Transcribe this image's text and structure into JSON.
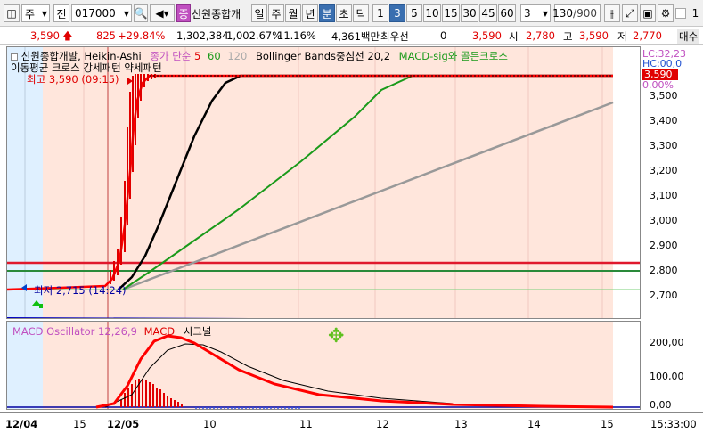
{
  "toolbar": {
    "stock_prefix": "주",
    "exchange_select": "전",
    "stock_code": "017000",
    "search_badge": "증",
    "stock_name": "신원종합개",
    "period_tabs": [
      "일",
      "주",
      "월",
      "년",
      "분",
      "초",
      "틱"
    ],
    "selected_period": "분",
    "minute_options": [
      "1",
      "3",
      "5",
      "10",
      "15",
      "30",
      "45",
      "60"
    ],
    "selected_minute": "3",
    "unit_value": "3",
    "count_display": "130",
    "count_total": "/900",
    "toggle_label": "1"
  },
  "quote": {
    "price": "3,590",
    "change": "825",
    "change_pct": "+29.84%",
    "volume": "1,302,384",
    "volume_ratio": "1,002.67%",
    "turnover_rate": "11.16%",
    "amount": "4,361백만",
    "pref_label": "최우선",
    "pref_value": "0",
    "ask": "3,590",
    "open_label": "시",
    "open": "2,780",
    "high_label": "고",
    "high": "3,590",
    "low_label": "저",
    "low": "2,770",
    "extra_label": "매수"
  },
  "main_legend": {
    "stock": "신원종합개발, Heikin-Ashi",
    "ma_label": "종가 단순",
    "ma5": "5",
    "ma60": "60",
    "ma120": "120",
    "bollinger": "Bollinger Bands중심선 20,2",
    "macd_signal": "MACD-sig와 골든크로스",
    "pattern_line": "이동평균 크로스 강세패턴   약세패턴",
    "high_marker": "최고 3,590 (09:15)",
    "low_marker": "최저 2,715 (14:24)"
  },
  "price_axis": {
    "lc": "LC:32,23",
    "hc": "HC:00,0",
    "current": "3,590",
    "current_pct": "0.00%",
    "ticks": [
      "3,500",
      "3,400",
      "3,300",
      "3,200",
      "3,100",
      "3,000",
      "2,900",
      "2,800",
      "2,700"
    ]
  },
  "osc_legend": {
    "osc": "MACD Oscillator 12,26,9",
    "macd": "MACD",
    "signal": "시그널"
  },
  "osc_axis": {
    "ticks": [
      "200,00",
      "100,00",
      "0,00"
    ]
  },
  "time_axis": {
    "labels": [
      "12/04",
      "15",
      "12/05",
      "10",
      "11",
      "12",
      "13",
      "14",
      "15"
    ],
    "clock": "15:33:00"
  },
  "colors": {
    "ma5": "#ff0000",
    "ma20": "#000000",
    "ma60": "#1a9a1a",
    "ma120": "#9a9a9a",
    "macd": "#ff0000",
    "bg_day1": "#dff0ff",
    "bg_day2": "#ffe8e0"
  }
}
